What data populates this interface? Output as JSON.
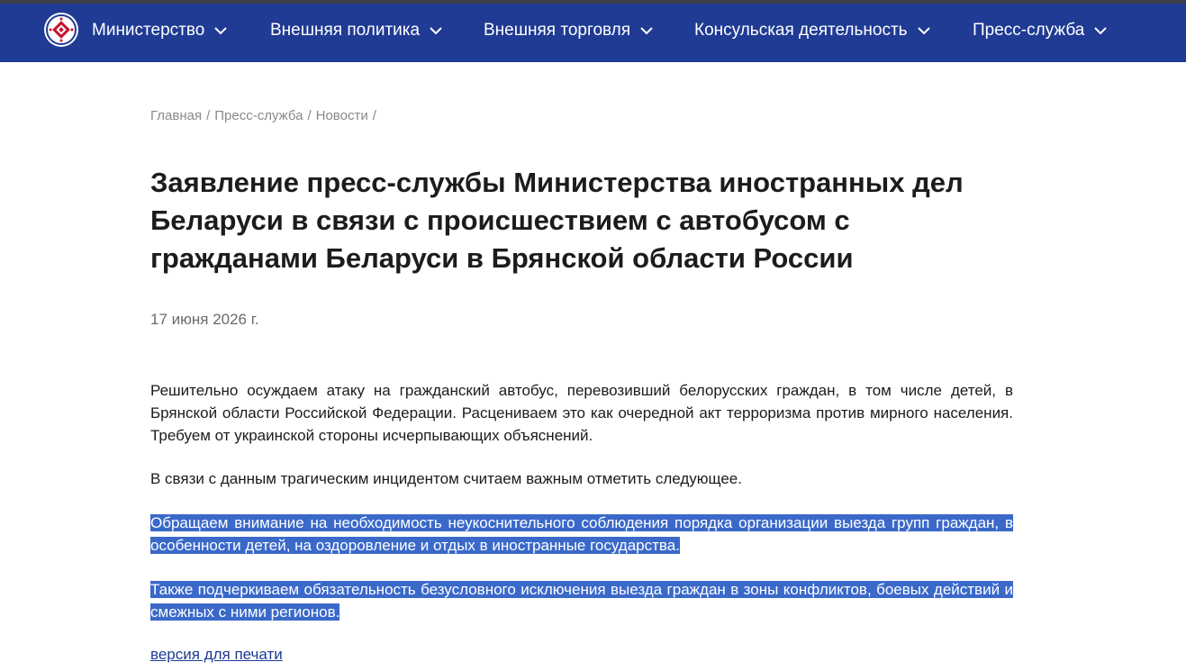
{
  "nav": {
    "items": [
      {
        "label": "Министерство"
      },
      {
        "label": "Внешняя политика"
      },
      {
        "label": "Внешняя торговля"
      },
      {
        "label": "Консульская деятельность"
      },
      {
        "label": "Пресс-служба"
      }
    ]
  },
  "breadcrumb": [
    {
      "label": "Главная"
    },
    {
      "label": "Пресс-служба"
    },
    {
      "label": "Новости"
    }
  ],
  "breadcrumb_separator": "/",
  "article": {
    "title": "Заявление пресс-службы Министерства иностранных дел Беларуси в связи с происшествием с автобусом с гражданами Беларуси в Брянской области России",
    "date": "17 июня 2026 г.",
    "paragraphs": [
      "Решительно осуждаем атаку на гражданский автобус, перевозивший белорусских граждан, в том числе детей, в Брянской области Российской Федерации. Расцениваем это как очередной акт терроризма против мирного населения. Требуем от украинской стороны исчерпывающих объяснений.",
      "В связи с данным трагическим инцидентом считаем важным отметить следующее.",
      "Обращаем внимание на необходимость неукоснительного соблюдения порядка организации выезда групп граждан, в особенности детей, на оздоровление и отдых в иностранные государства.",
      "Также подчеркиваем обязательность безусловного исключения выезда граждан в зоны конфликтов, боевых действий и смежных с ними регионов."
    ],
    "print_link": "версия для печати"
  },
  "colors": {
    "navbar": "#1f3b94",
    "selection": "#3a69c9",
    "link": "#1f3b94"
  },
  "icons": {
    "logo": "ministry-emblem-icon",
    "dropdown": "chevron-down-icon"
  }
}
